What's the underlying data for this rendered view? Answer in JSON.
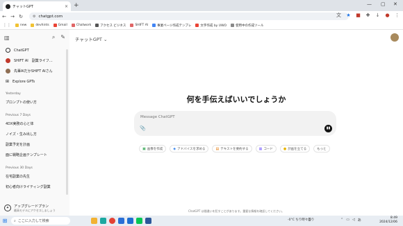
{
  "browser": {
    "tab_title": "チャットGPT",
    "url": "chatgpt.com",
    "bookmarks": [
      {
        "label": "new",
        "color": "#f1c232"
      },
      {
        "label": "devhints",
        "color": "#f1c232"
      },
      {
        "label": "Gmail",
        "color": "#ea4335"
      },
      {
        "label": "Chatwork",
        "color": "#e06666"
      },
      {
        "label": "アクセス ビジネス",
        "color": "#555555"
      },
      {
        "label": "SHIFT AI",
        "color": "#e06666"
      },
      {
        "label": "事業ページ作成テンプレ",
        "color": "#4285f4"
      },
      {
        "label": "文字作成 by UWO",
        "color": "#ea4335"
      },
      {
        "label": "使用中の作成ツール",
        "color": "#888888"
      }
    ]
  },
  "sidebar": {
    "items": [
      {
        "label": "ChatGPT",
        "icon": "openai-icon",
        "color": "#ffffff"
      },
      {
        "label": "SHIFT AI　副業ライフ…",
        "icon": "gpt-avatar-icon",
        "color": "#c0392b"
      },
      {
        "label": "先輩AIだかSHIFT AIさん",
        "icon": "gpt-avatar-icon",
        "color": "#8e6e53"
      },
      {
        "label": "Explore GPTs",
        "icon": "grid-icon",
        "color": "#ffffff"
      }
    ],
    "sections": [
      {
        "title": "Yesterday",
        "items": [
          "プロンプトの使い方"
        ]
      },
      {
        "title": "Previous 7 Days",
        "items": [
          "4DX実務の心と体",
          "ノイズ・生み出し方",
          "副業予定を計画",
          "面に戦略企画テンプレート"
        ]
      },
      {
        "title": "Previous 30 Days",
        "items": [
          "在宅副業の先生",
          "初心者向けライティング副業"
        ]
      }
    ],
    "upgrade": {
      "title": "アップグレードプラン",
      "subtitle": "最高モデルにアクセスしましょう"
    }
  },
  "main": {
    "model_label": "チャットGPT",
    "heading": "何を手伝えばいいでしょうか",
    "composer_placeholder": "Message ChatGPT",
    "suggestions": [
      {
        "label": "画像を作成",
        "icon": "image-icon",
        "color": "#2ea44f"
      },
      {
        "label": "アドバイスを求める",
        "icon": "cap-icon",
        "color": "#1a73e8"
      },
      {
        "label": "テキストを要約する",
        "icon": "doc-icon",
        "color": "#e37400"
      },
      {
        "label": "コード",
        "icon": "code-icon",
        "color": "#7b61ff"
      },
      {
        "label": "計画を立てる",
        "icon": "bulb-icon",
        "color": "#e8b400"
      },
      {
        "label": "もっと",
        "icon": "",
        "color": "#555555"
      }
    ],
    "disclaimer": "ChatGPT は間違いを犯すことがあります。重要な情報を確認してください。"
  },
  "taskbar": {
    "search_placeholder": "ここに入力して検索",
    "weather": "-0°C ちり時々曇り",
    "time": "8:49",
    "date": "2024/12/06",
    "apps": [
      {
        "name": "explorer-icon",
        "color": "#f2b233"
      },
      {
        "name": "edge-icon",
        "color": "#1ba8a0"
      },
      {
        "name": "chrome-icon",
        "color": "#e44134"
      },
      {
        "name": "store-icon",
        "color": "#2a6fd6"
      },
      {
        "name": "mail-icon",
        "color": "#1f6fd1"
      },
      {
        "name": "line-icon",
        "color": "#06c755"
      },
      {
        "name": "word-icon",
        "color": "#2b579a"
      }
    ]
  }
}
